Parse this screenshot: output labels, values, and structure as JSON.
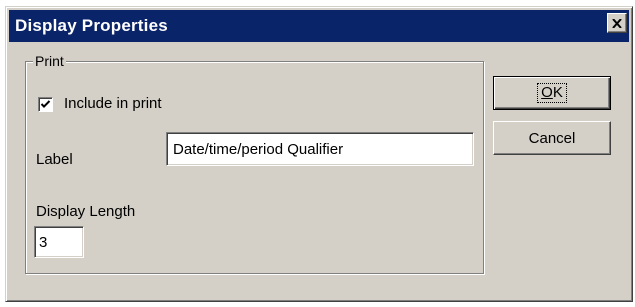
{
  "dialog": {
    "title": "Display Properties",
    "close_icon": "close-x-icon"
  },
  "print_group": {
    "label": "Print",
    "include_in_print": {
      "label": "Include in print",
      "checked": true
    },
    "label_field": {
      "label": "Label",
      "value": "Date/time/period Qualifier"
    },
    "display_length": {
      "label": "Display Length",
      "value": "3"
    }
  },
  "buttons": {
    "ok_accel": "O",
    "ok_rest": "K",
    "cancel_label": "Cancel"
  },
  "colors": {
    "titlebar": "#0a246a",
    "face": "#d4d0c8"
  }
}
